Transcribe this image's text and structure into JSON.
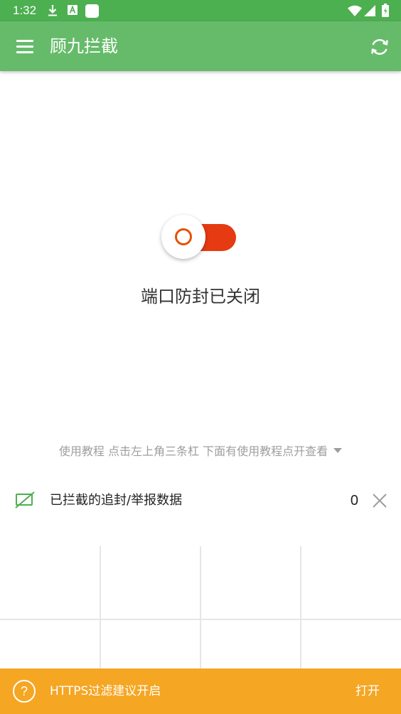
{
  "status_bar": {
    "time": "1:32",
    "icons": [
      "download-icon",
      "font-a-icon",
      "square-app-icon",
      "wifi-icon",
      "signal-icon",
      "battery-charging-icon"
    ]
  },
  "app_bar": {
    "title": "顾九拦截",
    "menu_icon": "hamburger-menu-icon",
    "refresh_icon": "refresh-icon"
  },
  "main": {
    "toggle": {
      "state": "off"
    },
    "status_text": "端口防封已关闭",
    "tutorial_hint": "使用教程 点击左上角三条杠 下面有使用教程点开查看"
  },
  "blocked": {
    "label": "已拦截的追封/举报数据",
    "count": "0"
  },
  "https_banner": {
    "icon": "question-mark-icon",
    "text": "HTTPS过滤建议开启",
    "action": "打开"
  },
  "colors": {
    "status_bar": "#4caf50",
    "app_bar": "#66bb6a",
    "toggle_track": "#e53a12",
    "toggle_ring": "#e65100",
    "banner": "#f5a623",
    "hint_text": "#9e9e9e"
  }
}
